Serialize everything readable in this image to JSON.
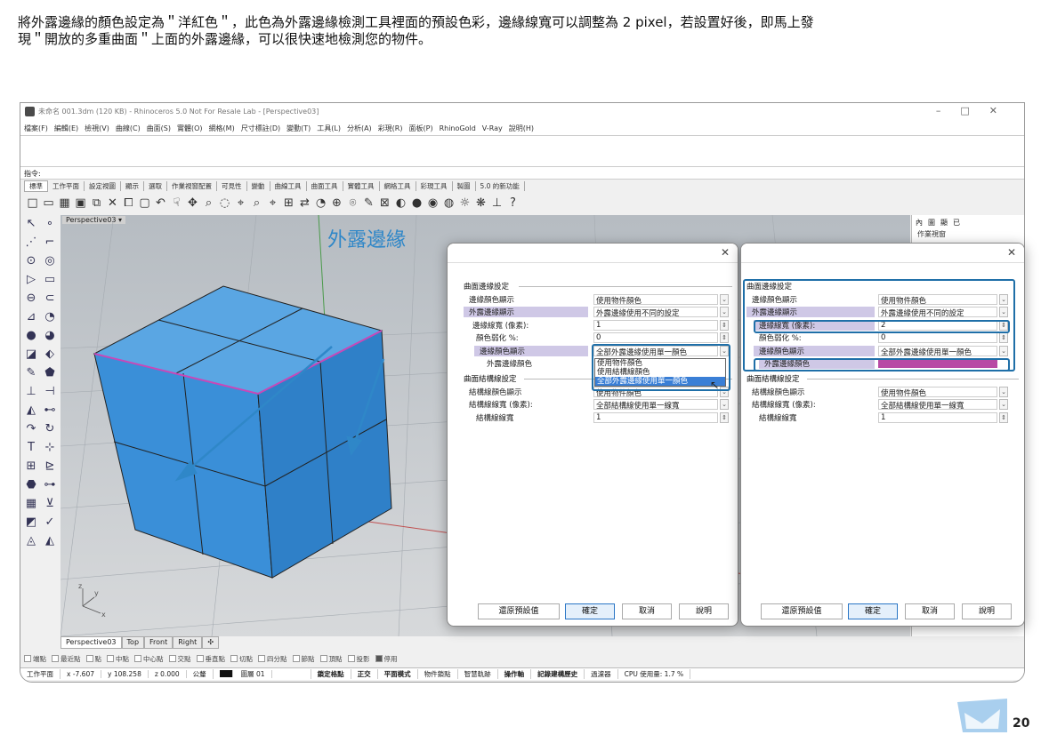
{
  "caption": "將外露邊緣的顏色設定為＂洋紅色＂，此色為外露邊緣檢測工具裡面的預設色彩，邊緣線寬可以調整為 2 pixel，若設置好後，即馬上發現＂開放的多重曲面＂上面的外露邊緣，可以很快速地檢測您的物件。",
  "window": {
    "title": "未命名 001.3dm (120 KB) - Rhinoceros 5.0 Not For Resale Lab - [Perspective03]",
    "menu": [
      "檔案(F)",
      "編輯(E)",
      "檢視(V)",
      "曲線(C)",
      "曲面(S)",
      "實體(O)",
      "網格(M)",
      "尺寸標註(D)",
      "變動(T)",
      "工具(L)",
      "分析(A)",
      "彩現(R)",
      "面板(P)",
      "RhinoGold",
      "V-Ray",
      "說明(H)"
    ],
    "command_label": "指令:",
    "toolbar_tabs": [
      "標準",
      "工作平面",
      "設定視圖",
      "顯示",
      "選取",
      "作業視窗配置",
      "可見性",
      "變動",
      "曲線工具",
      "曲面工具",
      "實體工具",
      "網格工具",
      "彩現工具",
      "製圖",
      "5.0 的新功能"
    ],
    "toolbar_icons": [
      "□",
      "▭",
      "▦",
      "▣",
      "⧉",
      "✕",
      "⧠",
      "▢",
      "↶",
      "☟",
      "✥",
      "⌕",
      "◌",
      "⌖",
      "⌕",
      "⌖",
      "⊞",
      "⇄",
      "◔",
      "⊕",
      "⌾",
      "✎",
      "⊠",
      "◐",
      "●",
      "◉",
      "◍",
      "☼",
      "❋",
      "⊥",
      "?"
    ],
    "left_icons": [
      "↖",
      "∘",
      "⋰",
      "⌐",
      "⊙",
      "◎",
      "▷",
      "▭",
      "⊖",
      "⊂",
      "⊿",
      "◔",
      "●",
      "◕",
      "◪",
      "⬖",
      "✎",
      "⬟",
      "⊥",
      "⊣",
      "◭",
      "⊷",
      "↷",
      "↻",
      "T",
      "⊹",
      "⊞",
      "⊵",
      "⬣",
      "⊶",
      "▦",
      "⊻",
      "◩",
      "✓",
      "◬",
      "◭"
    ],
    "viewport_label": "Perspective03",
    "viewport_tabs": [
      "Perspective03",
      "Top",
      "Front",
      "Right",
      "✣"
    ],
    "osnap": [
      "端點",
      "最近點",
      "點",
      "中點",
      "中心點",
      "交點",
      "垂直點",
      "切點",
      "四分點",
      "節點",
      "頂點",
      "投影",
      "停用"
    ],
    "status": {
      "cplane": "工作平面",
      "x": "x -7.607",
      "y": "y 108.258",
      "z": "z 0.000",
      "unit": "公釐",
      "layer": "圖層 01",
      "modes": [
        "鎖定格點",
        "正交",
        "平面模式",
        "物件鎖點",
        "智慧軌跡",
        "操作軸",
        "記錄建構歷史",
        "過濾器"
      ],
      "cpu": "CPU 使用量: 1.7 %"
    },
    "right_panel_tabs": [
      "內",
      "圖",
      "顯",
      "已"
    ],
    "right_panel_title": "作業視窗"
  },
  "overlay_label": "外露邊緣",
  "dialog1": {
    "close": "✕",
    "group1_title": "曲面邊緣設定",
    "rows1": [
      {
        "label": "邊緣顏色顯示",
        "value": "使用物件顏色"
      },
      {
        "label": "外露邊緣顯示",
        "value": "外露邊緣使用不同的設定"
      },
      {
        "label": "邊緣線寬 (像素):",
        "value": "1"
      },
      {
        "label": "顏色弱化 %:",
        "value": "0"
      },
      {
        "label": "邊緣顏色顯示",
        "value": "全部外露邊緣使用單一顏色"
      },
      {
        "label": "外露邊緣顏色",
        "value": ""
      }
    ],
    "popup_options": [
      "使用物件顏色",
      "使用結構線顏色",
      "全部外露邊緣使用單一顏色"
    ],
    "group2_title": "曲面結構線設定",
    "rows2": [
      {
        "label": "結構線顏色顯示",
        "value": "使用物件顏色"
      },
      {
        "label": "結構線線寬 (像素):",
        "value": "全部結構線使用單一線寬"
      },
      {
        "label": "結構線線寬",
        "value": "1"
      }
    ],
    "buttons": {
      "restore": "還原預設值",
      "ok": "確定",
      "cancel": "取消",
      "help": "說明"
    }
  },
  "dialog2": {
    "close": "✕",
    "group1_title": "曲面邊緣設定",
    "rows1": [
      {
        "label": "邊緣顏色顯示",
        "value": "使用物件顏色"
      },
      {
        "label": "外露邊緣顯示",
        "value": "外露邊緣使用不同的設定"
      },
      {
        "label": "邊緣線寬 (像素):",
        "value": "2"
      },
      {
        "label": "顏色弱化 %:",
        "value": "0"
      },
      {
        "label": "邊緣顏色顯示",
        "value": "全部外露邊緣使用單一顏色"
      },
      {
        "label": "外露邊緣顏色",
        "value": ""
      }
    ],
    "naked_edge_color": "#b84aa5",
    "group2_title": "曲面結構線設定",
    "rows2": [
      {
        "label": "結構線顏色顯示",
        "value": "使用物件顏色"
      },
      {
        "label": "結構線線寬 (像素):",
        "value": "全部結構線使用單一線寬"
      },
      {
        "label": "結構線線寬",
        "value": "1"
      }
    ],
    "buttons": {
      "restore": "還原預設值",
      "ok": "確定",
      "cancel": "取消",
      "help": "說明"
    }
  },
  "page_number": "20",
  "colors": {
    "accent": "#1f6fa8",
    "cube": "#3a8fd8",
    "magenta": "#b84aa5"
  }
}
